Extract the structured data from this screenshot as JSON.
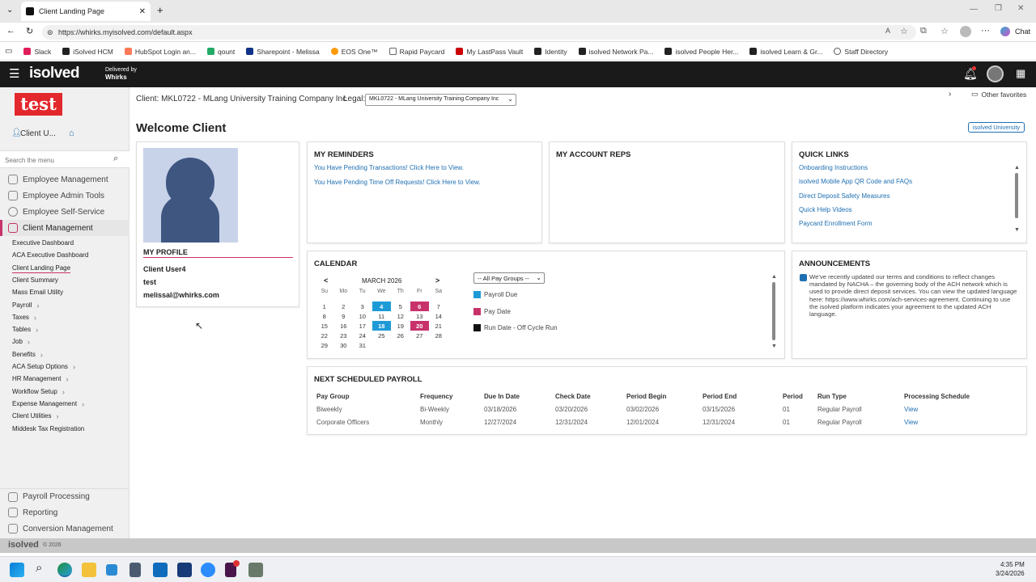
{
  "browser": {
    "tab_title": "Client Landing Page",
    "url": "https://whirks.myisolved.com/default.aspx",
    "favorites": [
      "Slack",
      "iSolved HCM",
      "HubSpot Login an...",
      "qount",
      "Sharepoint - Melissa",
      "EOS One™",
      "Rapid Paycard",
      "My LastPass Vault",
      "Identity",
      "isolved Network Pa...",
      "isolved People Her...",
      "isolved Learn & Gr...",
      "Staff Directory"
    ],
    "other_favorites": "Other favorites",
    "chat_label": "Chat"
  },
  "header": {
    "logo": "isolved",
    "delivered_by": "Delivered by",
    "delivered_by_name": "Whirks"
  },
  "sidebar": {
    "brand_logo": "test",
    "user_label": "Client U...",
    "search_placeholder": "Search the menu",
    "main_items": [
      "Employee Management",
      "Employee Admin Tools",
      "Employee Self-Service",
      "Client Management"
    ],
    "sub_items": [
      {
        "label": "Executive Dashboard",
        "chev": false
      },
      {
        "label": "ACA Executive Dashboard",
        "chev": false
      },
      {
        "label": "Client Landing Page",
        "chev": false
      },
      {
        "label": "Client Summary",
        "chev": false
      },
      {
        "label": "Mass Email Utility",
        "chev": false
      },
      {
        "label": "Payroll",
        "chev": true
      },
      {
        "label": "Taxes",
        "chev": true
      },
      {
        "label": "Tables",
        "chev": true
      },
      {
        "label": "Job",
        "chev": true
      },
      {
        "label": "Benefits",
        "chev": true
      },
      {
        "label": "ACA Setup Options",
        "chev": true
      },
      {
        "label": "HR Management",
        "chev": true
      },
      {
        "label": "Workflow Setup",
        "chev": true
      },
      {
        "label": "Expense Management",
        "chev": true
      },
      {
        "label": "Client Utilities",
        "chev": true
      },
      {
        "label": "Middesk Tax Registration",
        "chev": false
      }
    ],
    "bottom_items": [
      "Payroll Processing",
      "Reporting",
      "Conversion Management"
    ]
  },
  "main": {
    "client_label": "Client: MKL0722 - MLang University Training Company Inc",
    "legal_label": "Legal:",
    "legal_value": "MKL0722 - MLang University Training Company Inc",
    "welcome": "Welcome Client",
    "university_button": "isolved University",
    "profile": {
      "title": "MY PROFILE",
      "name": "Client User4",
      "company": "test",
      "email": "melissal@whirks.com"
    },
    "reminders": {
      "title": "MY REMINDERS",
      "items": [
        "You Have Pending Transactions! Click Here to View.",
        "You Have Pending Time Off Requests! Click Here to View."
      ]
    },
    "account_reps": {
      "title": "MY ACCOUNT REPS"
    },
    "quick_links": {
      "title": "QUICK LINKS",
      "items": [
        "Onboarding Instructions",
        "isolved Mobile App QR Code and FAQs",
        "Direct Deposit Safety Measures",
        "Quick Help Videos",
        "Paycard Enrollment Form"
      ]
    },
    "calendar": {
      "title": "CALENDAR",
      "month": "MARCH 2026",
      "prev": "<",
      "next": ">",
      "weekdays": [
        "Su",
        "Mo",
        "Tu",
        "We",
        "Th",
        "Fr",
        "Sa"
      ],
      "weeks": [
        [
          "1",
          "2",
          "3",
          "4",
          "5",
          "6",
          "7"
        ],
        [
          "8",
          "9",
          "10",
          "11",
          "12",
          "13",
          "14"
        ],
        [
          "15",
          "16",
          "17",
          "18",
          "19",
          "20",
          "21"
        ],
        [
          "22",
          "23",
          "24",
          "25",
          "26",
          "27",
          "28"
        ],
        [
          "29",
          "30",
          "31",
          "",
          "",
          "",
          ""
        ]
      ],
      "pay_group_select": "-- All Pay Groups --",
      "legend": [
        {
          "label": "Payroll Due",
          "color": "#1e9bd7"
        },
        {
          "label": "Pay Date",
          "color": "#c8326b"
        },
        {
          "label": "Run Date - Off Cycle Run",
          "color": "#111111"
        }
      ]
    },
    "announcements": {
      "title": "ANNOUNCEMENTS",
      "text": "We've recently updated our terms and conditions to reflect changes mandated by NACHA – the governing body of the ACH network which is used to provide direct deposit services. You can view the updated language here: https://www.whirks.com/ach-services-agreement. Continuing to use the isolved platform indicates your agreement to the updated ACH language."
    },
    "next_payroll": {
      "title": "NEXT SCHEDULED PAYROLL",
      "columns": [
        "Pay Group",
        "Frequency",
        "Due In Date",
        "Check Date",
        "Period Begin",
        "Period End",
        "Period",
        "Run Type",
        "Processing Schedule"
      ],
      "rows": [
        [
          "Biweekly",
          "Bi-Weekly",
          "03/18/2026",
          "03/20/2026",
          "03/02/2026",
          "03/15/2026",
          "01",
          "Regular Payroll",
          "View"
        ],
        [
          "Corporate Officers",
          "Monthly",
          "12/27/2024",
          "12/31/2024",
          "12/01/2024",
          "12/31/2024",
          "01",
          "Regular Payroll",
          "View"
        ]
      ]
    }
  },
  "footer": {
    "logo": "isolved",
    "copyright": "© 2026"
  },
  "taskbar": {
    "time": "4:35 PM",
    "date": "3/24/2026"
  }
}
